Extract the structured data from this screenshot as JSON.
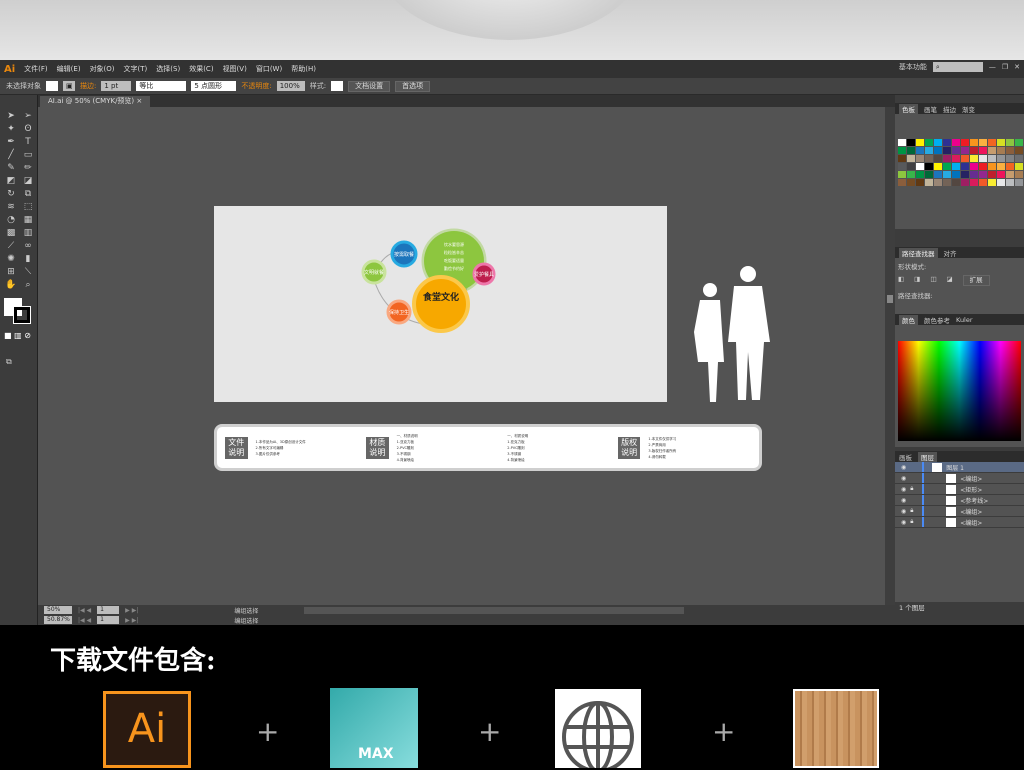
{
  "app": {
    "logo": "Ai",
    "menus": [
      "文件(F)",
      "编辑(E)",
      "对象(O)",
      "文字(T)",
      "选择(S)",
      "效果(C)",
      "视图(V)",
      "窗口(W)",
      "帮助(H)"
    ],
    "workspace": "基本功能"
  },
  "control": {
    "selection": "未选择对象",
    "stroke_label": "描边:",
    "stroke_value": "1 pt",
    "profile": "等比",
    "brush": "5 点圆形",
    "opacity_label": "不透明度:",
    "opacity_value": "100%",
    "style_label": "样式:",
    "doc_setup": "文档设置",
    "prefs": "首选项"
  },
  "document": {
    "tab": "AI.ai @ 50% (CMYK/预览)"
  },
  "artwork": {
    "center_title": "食堂文化",
    "bubbles": [
      "文明就餐",
      "按需取餐",
      "爱护餐具",
      "保持卫生"
    ],
    "list": [
      "饮水要思源",
      "粒粒皆辛苦",
      "吃饭要适量",
      "勤俭节约好"
    ]
  },
  "info": {
    "sections": [
      {
        "badge": "文件说明",
        "lines": [
          "1.本作品为AI、3D原创设计文件",
          "2.所有文字可编辑",
          "3.图片仅供参考"
        ]
      },
      {
        "badge": "材质说明",
        "lines": [
          "一、材质说明",
          "1.亚克力板",
          "2.PVC雕刻",
          "3.不锈钢",
          "4.背景喷绘"
        ]
      },
      {
        "badge": "",
        "lines": [
          "一、材质说明",
          "1.亚克力板",
          "2.PVC雕刻",
          "3.不锈钢",
          "4.背景喷绘"
        ]
      },
      {
        "badge": "版权说明",
        "lines": [
          "1.本文件仅供学习",
          "2.严禁商用",
          "3.版权归作者所有",
          "4.请勿转载"
        ]
      }
    ]
  },
  "status": {
    "zoom": "50%",
    "zoom2": "50.87%",
    "page": "1",
    "label": "编组选择"
  },
  "panels": {
    "swatch_tabs": [
      "色板",
      "画笔",
      "描边",
      "渐变"
    ],
    "path_tabs": [
      "路径查找器",
      "对齐"
    ],
    "shape_modes": "形状模式:",
    "expand": "扩展",
    "pathfinders": "路径查找器:",
    "color_tabs": [
      "颜色",
      "颜色参考",
      "Kuler"
    ],
    "layer_tabs": [
      "画板",
      "图层"
    ],
    "layers": [
      {
        "name": "图层 1",
        "lock": false
      },
      {
        "name": "<编组>",
        "lock": false
      },
      {
        "name": "<矩形>",
        "lock": true
      },
      {
        "name": "<参考线>",
        "lock": false
      },
      {
        "name": "<编组>",
        "lock": true
      },
      {
        "name": "<编组>",
        "lock": true
      }
    ],
    "layer_count": "1 个图层"
  },
  "swatch_colors": [
    "#ffffff",
    "#000000",
    "#fff200",
    "#00a651",
    "#00aeef",
    "#2e3192",
    "#ec008c",
    "#ed1c24",
    "#f7941d",
    "#fbb040",
    "#f26522",
    "#d7df23",
    "#8dc63f",
    "#39b54a",
    "#009444",
    "#006838",
    "#1c75bc",
    "#27aae1",
    "#0072bc",
    "#262262",
    "#662d91",
    "#92278f",
    "#be1e2d",
    "#ed145b",
    "#c69c6d",
    "#a67c52",
    "#8b5e3c",
    "#754c24",
    "#603913",
    "#c2b59b",
    "#998675",
    "#736357",
    "#534741",
    "#9e1f63",
    "#da1c5c",
    "#f15a29",
    "#f9ed32",
    "#e6e7e8",
    "#bcbec0",
    "#939598",
    "#808285",
    "#6d6e71",
    "#58595b",
    "#414042"
  ],
  "bottom": {
    "title": "下载文件包含:",
    "items": [
      "Ai",
      "MAX",
      "",
      ""
    ],
    "plus": "+"
  }
}
